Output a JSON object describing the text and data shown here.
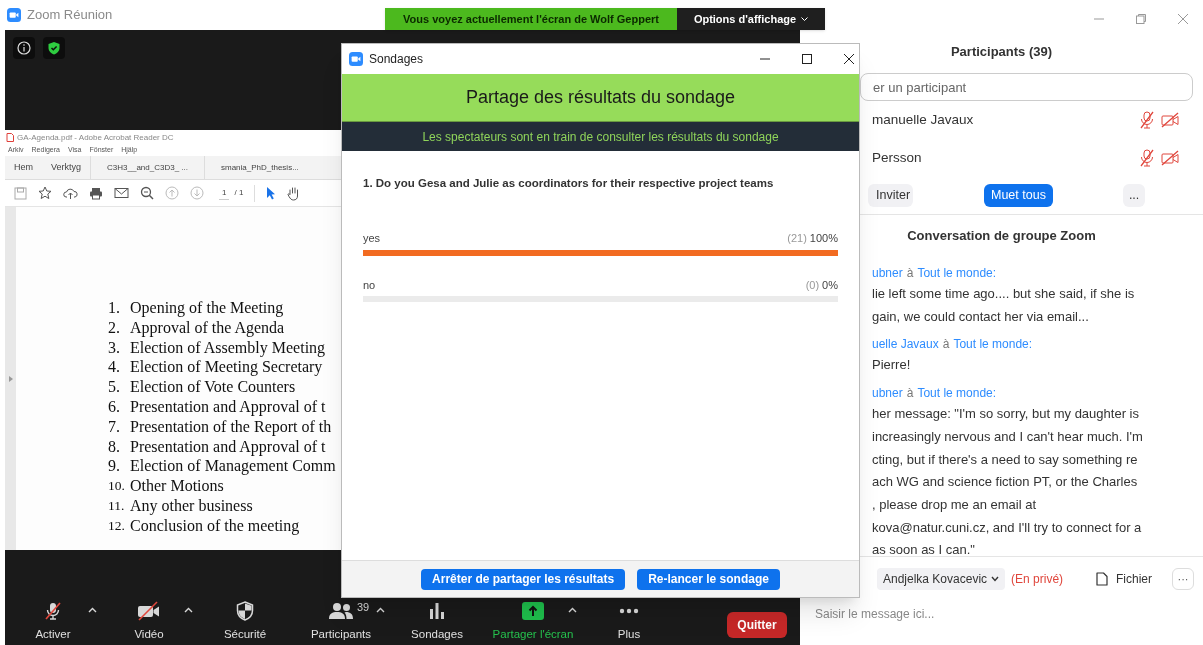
{
  "window": {
    "title": "Zoom Réunion"
  },
  "share_banner": {
    "text": "Vous voyez actuellement l'écran de Wolf Geppert",
    "options": "Options d'affichage"
  },
  "shared_screen": {
    "app_title": "GA-Agenda.pdf - Adobe Acrobat Reader DC",
    "menu": [
      "Arkiv",
      "Redigera",
      "Visa",
      "Fönster",
      "Hjälp"
    ],
    "tabs": [
      "Hem",
      "Verktyg",
      "C3H3__and_C3D3_ ...",
      "smania_PhD_thesis..."
    ],
    "page_number": "1",
    "page_total": "/ 1",
    "agenda": [
      {
        "number": "1.",
        "text": "Opening of the Meeting"
      },
      {
        "number": "2.",
        "text": "Approval of the Agenda"
      },
      {
        "number": "3.",
        "text": "Election of Assembly Meeting"
      },
      {
        "number": "4.",
        "text": "Election of Meeting Secretary"
      },
      {
        "number": "5.",
        "text": "Election of Vote Counters"
      },
      {
        "number": "6.",
        "text": "Presentation and Approval of t"
      },
      {
        "number": "7.",
        "text": "Presentation of the Report of th"
      },
      {
        "number": "8.",
        "text": "Presentation and Approval of t"
      },
      {
        "number": "9.",
        "text": "Election of Management Comm"
      },
      {
        "number": "10.",
        "text": "Other Motions"
      },
      {
        "number": "11.",
        "text": "Any other business"
      },
      {
        "number": "12.",
        "text": "Conclusion of the meeting"
      }
    ]
  },
  "toolbar": [
    {
      "kind": "mic-muted",
      "label": "Activer",
      "menu": true,
      "highlighted": false
    },
    {
      "kind": "video-off",
      "label": "Vidéo",
      "menu": true,
      "highlighted": false
    },
    {
      "kind": "shield",
      "label": "Sécurité",
      "menu": false,
      "highlighted": false
    },
    {
      "kind": "people",
      "label": "Participants",
      "count": "39",
      "menu": true,
      "highlighted": false
    },
    {
      "kind": "chart",
      "label": "Sondages",
      "menu": false,
      "highlighted": false
    },
    {
      "kind": "share",
      "label": "Partager l'écran",
      "menu": true,
      "highlighted": true
    },
    {
      "kind": "dots",
      "label": "Plus",
      "menu": false,
      "highlighted": false
    }
  ],
  "leave_button": "Quitter",
  "poll_dialog": {
    "title": "Sondages",
    "header": "Partage des résultats du sondage",
    "status": "Les spectateurs sont en train de consulter les résultats du sondage",
    "question": "1. Do you Gesa and Julie as coordinators for their respective project teams",
    "answers": [
      {
        "label": "yes",
        "count": "(21)",
        "percent": "100%",
        "level": 1
      },
      {
        "label": "no",
        "count": "(0)",
        "percent": "0%",
        "level": 0
      }
    ],
    "buttons": [
      "Arrêter de partager les résultats",
      "Re-lancer le sondage"
    ]
  },
  "participants_panel": {
    "title": "Participants (39)",
    "search_placeholder": "er un participant",
    "participants": [
      {
        "name": "manuelle Javaux",
        "muted": true,
        "video_off": true
      },
      {
        "name": "Persson",
        "muted": true,
        "video_off": true
      }
    ],
    "buttons": [
      "Inviter",
      "Muet tous",
      "..."
    ]
  },
  "chat": {
    "title": "Conversation de groupe Zoom",
    "messages": [
      {
        "sender": "ubner",
        "to_word": "à",
        "recipient": "Tout le monde:",
        "lines": [
          "lie left some time ago.... but she said, if she is",
          "gain, we could contact her via email..."
        ]
      },
      {
        "sender": "uelle Javaux",
        "to_word": "à",
        "recipient": "Tout le monde:",
        "lines": [
          "Pierre!"
        ]
      },
      {
        "sender": "ubner",
        "to_word": "à",
        "recipient": "Tout le monde:",
        "lines": [
          "her message: \"I'm so sorry, but my daughter is",
          "increasingly nervous and I can't hear much. I'm",
          "cting, but if there's a need to say something re",
          "ach WG and science fiction PT, or the Charles",
          ", please drop me an email at",
          "kova@natur.cuni.cz, and I'll try to connect for a",
          "as soon as I can.\""
        ]
      }
    ],
    "send_to": "Andjelka Kovacevic",
    "private_label": "(En privé)",
    "file_button": "Fichier",
    "more_button": "···",
    "input_placeholder": "Saisir le message ici..."
  }
}
